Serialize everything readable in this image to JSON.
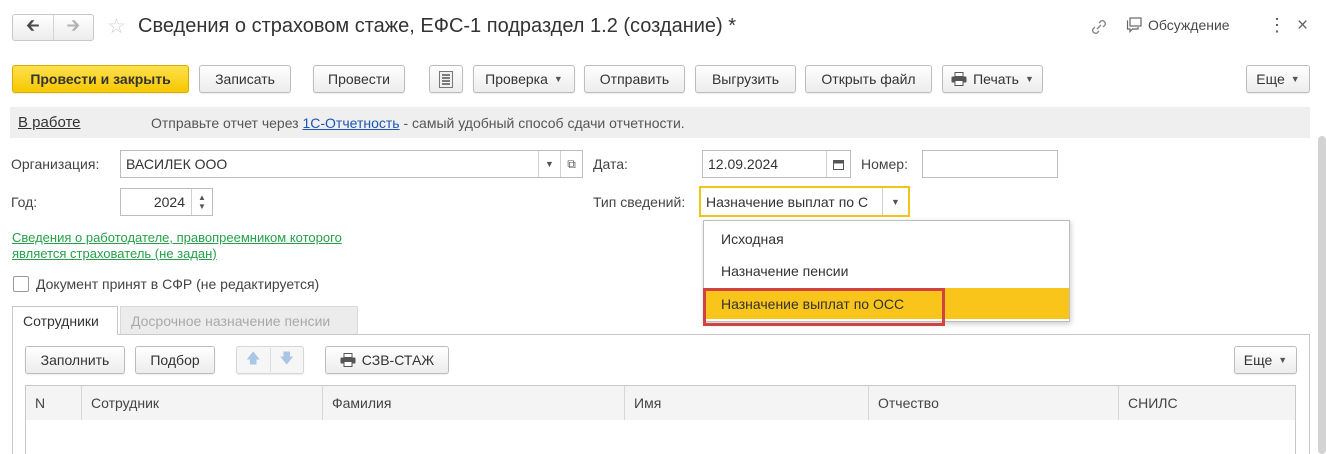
{
  "window": {
    "title": "Сведения о страховом стаже, ЕФС-1 подраздел 1.2 (создание) *",
    "discussion_label": "Обсуждение",
    "more_icon": "⋮",
    "close_icon": "×"
  },
  "toolbar": {
    "post_close": "Провести и закрыть",
    "write": "Записать",
    "post": "Провести",
    "check": "Проверка",
    "send": "Отправить",
    "export": "Выгрузить",
    "open_file": "Открыть файл",
    "print": "Печать",
    "more": "Еще"
  },
  "status_bar": {
    "status": "В работе",
    "text_before": "Отправьте отчет через ",
    "link": "1С-Отчетность",
    "text_after": " - самый удобный способ сдачи отчетности."
  },
  "form": {
    "org_label": "Организация:",
    "org_value": "ВАСИЛЕК ООО",
    "date_label": "Дата:",
    "date_value": "12.09.2024",
    "number_label": "Номер:",
    "number_value": "",
    "year_label": "Год:",
    "year_value": "2024",
    "type_label": "Тип сведений:",
    "type_value": "Назначение выплат по С",
    "employer_link_line1": "Сведения о работодателе, правопреемником которого ",
    "employer_link_line2": "является страхователь (не задан)",
    "accepted_label": "Документ принят в СФР (не редактируется)"
  },
  "dropdown": {
    "options": [
      "Исходная",
      "Назначение пенсии",
      "Назначение выплат по ОСС"
    ],
    "selected_index": 2
  },
  "tabs": {
    "employees": "Сотрудники",
    "early_pension": "Досрочное назначение пенсии"
  },
  "table_toolbar": {
    "fill": "Заполнить",
    "select": "Подбор",
    "szv": "СЗВ-СТАЖ",
    "more": "Еще"
  },
  "table": {
    "columns": [
      "N",
      "Сотрудник",
      "Фамилия",
      "Имя",
      "Отчество",
      "СНИЛС"
    ]
  },
  "colors": {
    "primary_button": "#f6c700",
    "selected_option": "#f9c51a",
    "highlight_frame": "#d14343",
    "link_blue": "#1a57b5",
    "link_green": "#25a04a"
  }
}
